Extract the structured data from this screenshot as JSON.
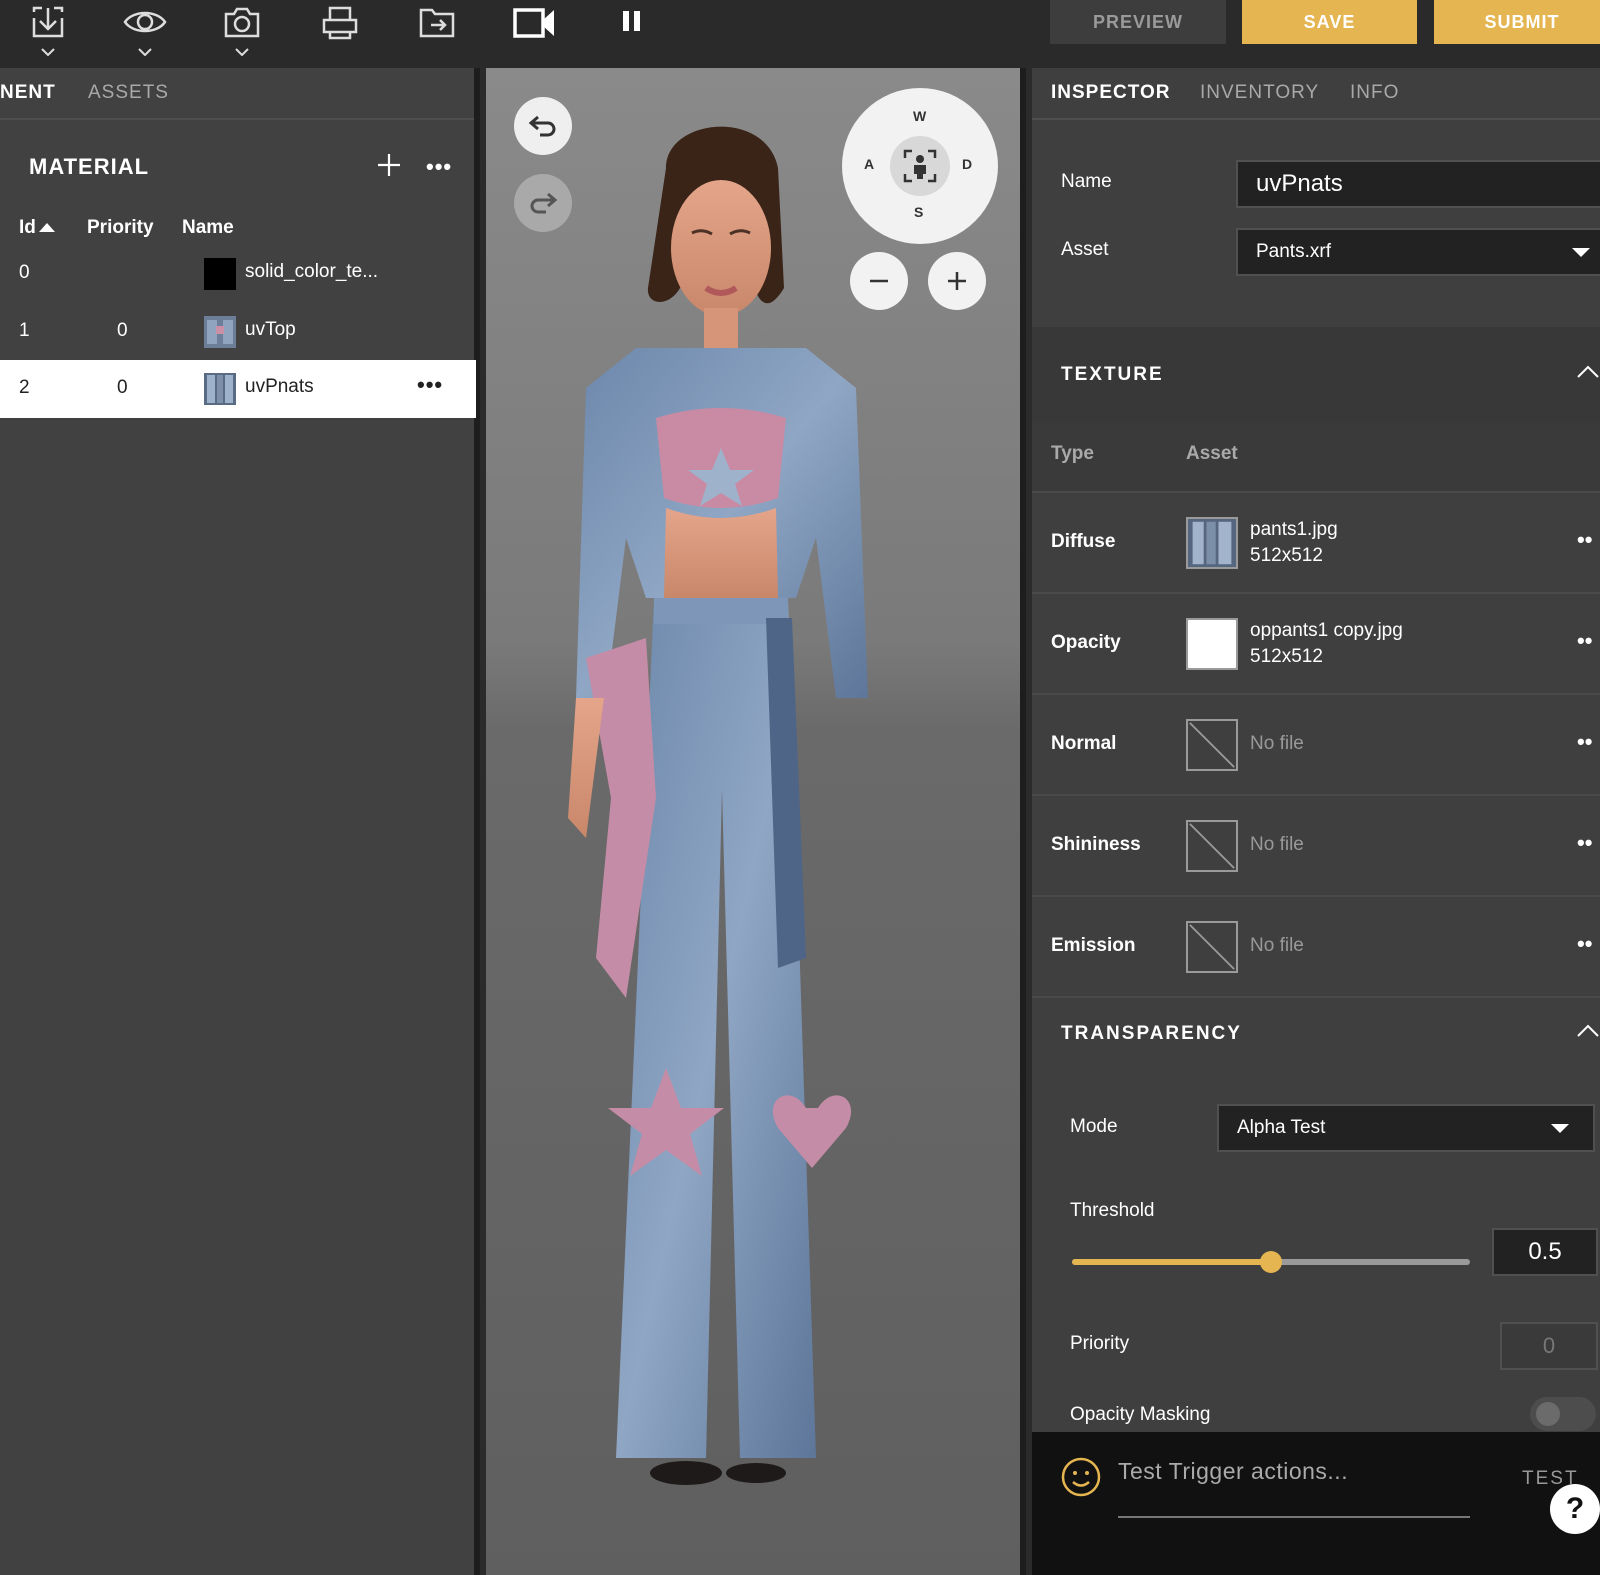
{
  "toolbar": {
    "icons": [
      "download-icon",
      "eye-icon",
      "camera-icon",
      "print-icon",
      "export-folder-icon",
      "video-camera-icon",
      "pause-icon"
    ],
    "preview_label": "PREVIEW",
    "save_label": "SAVE",
    "submit_label": "SUBMIT",
    "accent": "#e5b551"
  },
  "left_panel": {
    "tabs": [
      "NENT",
      "ASSETS"
    ],
    "material_title": "MATERIAL",
    "add_glyph": "+",
    "more_glyph": "•••",
    "columns": {
      "id": "Id",
      "priority": "Priority",
      "name": "Name"
    },
    "rows": [
      {
        "id": "0",
        "priority": "",
        "name": "solid_color_te...",
        "selected": false
      },
      {
        "id": "1",
        "priority": "0",
        "name": "uvTop",
        "selected": false
      },
      {
        "id": "2",
        "priority": "0",
        "name": "uvPnats",
        "selected": true
      }
    ]
  },
  "viewport": {
    "compass": {
      "north": "W",
      "west": "A",
      "east": "D",
      "south": "S"
    },
    "zoom_out": "−",
    "zoom_in": "+"
  },
  "inspector": {
    "tabs": [
      "INSPECTOR",
      "INVENTORY",
      "INFO"
    ],
    "name_label": "Name",
    "name_value": "uvPnats",
    "asset_label": "Asset",
    "asset_value": "Pants.xrf",
    "texture": {
      "title": "TEXTURE",
      "col_type": "Type",
      "col_asset": "Asset",
      "rows": [
        {
          "type": "Diffuse",
          "file": "pants1.jpg",
          "size": "512x512"
        },
        {
          "type": "Opacity",
          "file": "oppants1 copy.jpg",
          "size": "512x512"
        },
        {
          "type": "Normal",
          "file": "No file",
          "size": ""
        },
        {
          "type": "Shininess",
          "file": "No file",
          "size": ""
        },
        {
          "type": "Emission",
          "file": "No file",
          "size": ""
        }
      ],
      "more_glyph": "••"
    },
    "transparency": {
      "title": "TRANSPARENCY",
      "mode_label": "Mode",
      "mode_value": "Alpha Test",
      "threshold_label": "Threshold",
      "threshold_value": "0.5",
      "threshold_fraction": 0.5,
      "priority_label": "Priority",
      "priority_value": "0",
      "opacity_masking_label": "Opacity Masking",
      "opacity_masking_on": false
    }
  },
  "trigger": {
    "placeholder": "Test Trigger actions...",
    "test_label": "TEST",
    "help_glyph": "?"
  }
}
